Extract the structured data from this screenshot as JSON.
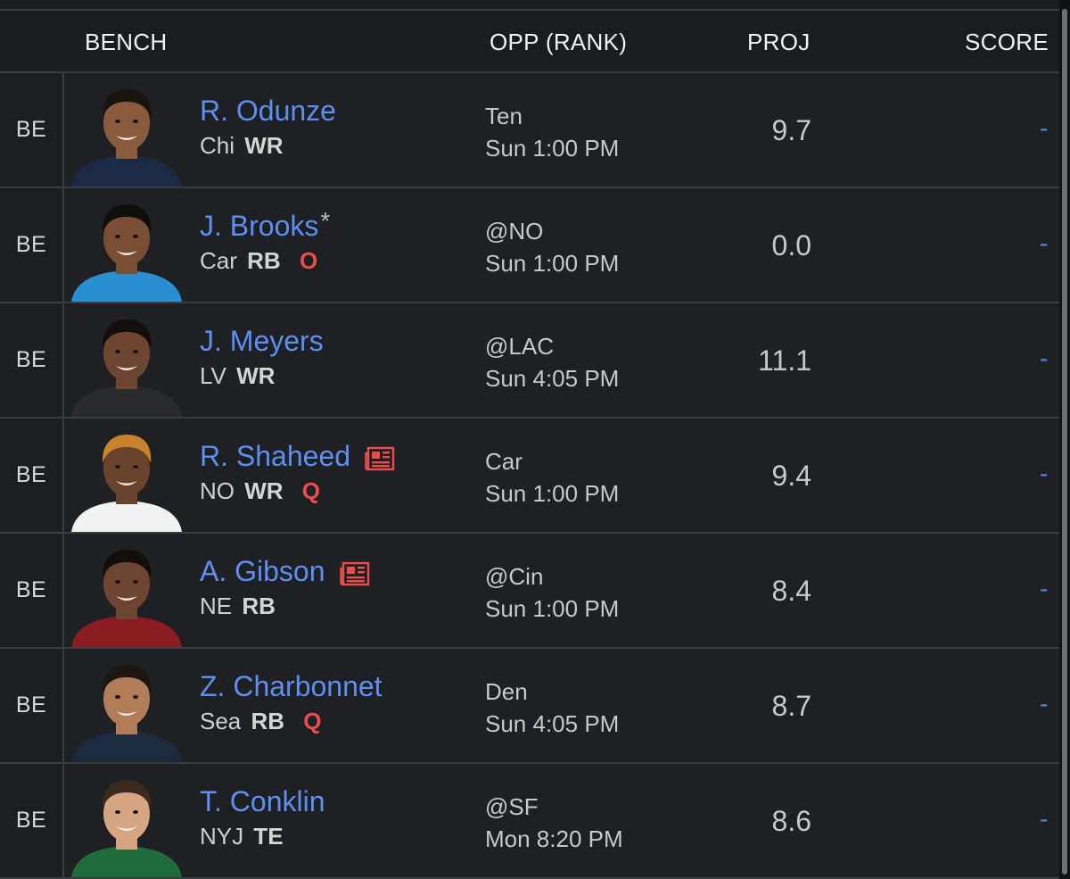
{
  "header": {
    "bench": "BENCH",
    "opp": "OPP (RANK)",
    "proj": "PROJ",
    "score": "SCORE"
  },
  "players": [
    {
      "slot": "BE",
      "name": "R. Odunze",
      "star": "",
      "team": "Chi",
      "position": "WR",
      "status": "",
      "news": false,
      "opp": "Ten",
      "time": "Sun 1:00 PM",
      "proj": "9.7",
      "score": "-",
      "jersey": "#1b2a44",
      "skin": "#8a5a3c",
      "hair": "#1a1410"
    },
    {
      "slot": "BE",
      "name": "J. Brooks",
      "star": "*",
      "team": "Car",
      "position": "RB",
      "status": "O",
      "news": false,
      "opp": "@NO",
      "time": "Sun 1:00 PM",
      "proj": "0.0",
      "score": "-",
      "jersey": "#2a8fd0",
      "skin": "#7a4e33",
      "hair": "#120e0b"
    },
    {
      "slot": "BE",
      "name": "J. Meyers",
      "star": "",
      "team": "LV",
      "position": "WR",
      "status": "",
      "news": false,
      "opp": "@LAC",
      "time": "Sun 4:05 PM",
      "proj": "11.1",
      "score": "-",
      "jersey": "#2b2b2e",
      "skin": "#6d4530",
      "hair": "#150f0b"
    },
    {
      "slot": "BE",
      "name": "R. Shaheed",
      "star": "",
      "team": "NO",
      "position": "WR",
      "status": "Q",
      "news": true,
      "opp": "Car",
      "time": "Sun 1:00 PM",
      "proj": "9.4",
      "score": "-",
      "jersey": "#f2f2f2",
      "skin": "#6a432c",
      "hair": "#c9822e"
    },
    {
      "slot": "BE",
      "name": "A. Gibson",
      "star": "",
      "team": "NE",
      "position": "RB",
      "status": "",
      "news": true,
      "opp": "@Cin",
      "time": "Sun 1:00 PM",
      "proj": "8.4",
      "score": "-",
      "jersey": "#8b1c22",
      "skin": "#6e4530",
      "hair": "#140f0c"
    },
    {
      "slot": "BE",
      "name": "Z. Charbonnet",
      "star": "",
      "team": "Sea",
      "position": "RB",
      "status": "Q",
      "news": false,
      "opp": "Den",
      "time": "Sun 4:05 PM",
      "proj": "8.7",
      "score": "-",
      "jersey": "#1b2b3f",
      "skin": "#b07d58",
      "hair": "#1d1611"
    },
    {
      "slot": "BE",
      "name": "T. Conklin",
      "star": "",
      "team": "NYJ",
      "position": "TE",
      "status": "",
      "news": false,
      "opp": "@SF",
      "time": "Mon 8:20 PM",
      "proj": "8.6",
      "score": "-",
      "jersey": "#1f6b3a",
      "skin": "#d6a682",
      "hair": "#3b2a1e"
    }
  ]
}
